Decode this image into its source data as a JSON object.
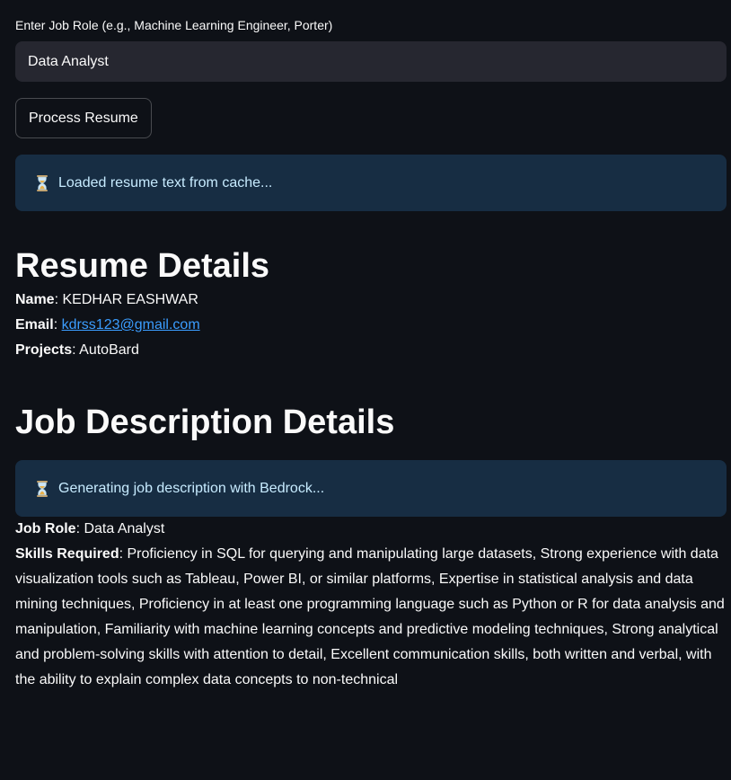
{
  "job_role_input": {
    "label": "Enter Job Role (e.g., Machine Learning Engineer, Porter)",
    "value": "Data Analyst"
  },
  "process_button": {
    "label": "Process Resume"
  },
  "alerts": {
    "cache": "Loaded resume text from cache...",
    "generating": "Generating job description with Bedrock..."
  },
  "resume": {
    "heading": "Resume Details",
    "name_label": "Name",
    "name_value": "KEDHAR EASHWAR",
    "email_label": "Email",
    "email_value": "kdrss123@gmail.com",
    "projects_label": "Projects",
    "projects_value": "AutoBard"
  },
  "job": {
    "heading": "Job Description Details",
    "role_label": "Job Role",
    "role_value": "Data Analyst",
    "skills_label": "Skills Required",
    "skills_value": "Proficiency in SQL for querying and manipulating large datasets, Strong experience with data visualization tools such as Tableau, Power BI, or similar platforms, Expertise in statistical analysis and data mining techniques, Proficiency in at least one programming language such as Python or R for data analysis and manipulation, Familiarity with machine learning concepts and predictive modeling techniques, Strong analytical and problem-solving skills with attention to detail, Excellent communication skills, both written and verbal, with the ability to explain complex data concepts to non-technical"
  },
  "icons": {
    "alert_icon": "hourglass-icon"
  },
  "colors": {
    "background": "#0e1117",
    "input_bg": "#262730",
    "alert_bg": "#172d43",
    "alert_text": "#c7ebff",
    "link": "#3b9dff"
  }
}
